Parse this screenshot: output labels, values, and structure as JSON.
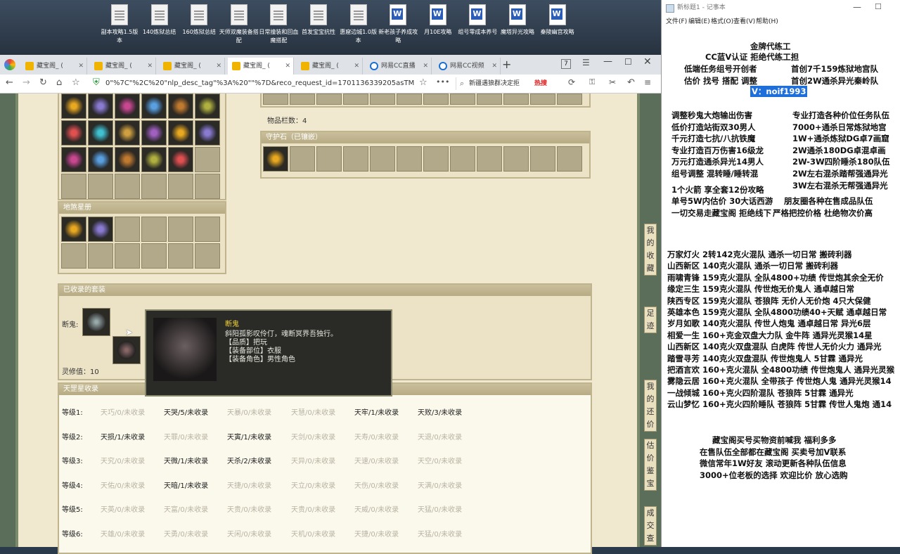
{
  "desktop": {
    "icons": [
      {
        "label": "副本攻略1.5版本",
        "type": "doc"
      },
      {
        "label": "140炼狱总结",
        "type": "doc"
      },
      {
        "label": "160炼狱总结",
        "type": "doc"
      },
      {
        "label": "天师双魔装备搭配",
        "type": "doc"
      },
      {
        "label": "日常撞装和回血魔搭配",
        "type": "doc"
      },
      {
        "label": "首发宝宝抗性",
        "type": "doc"
      },
      {
        "label": "惠窟边城1.0版本",
        "type": "doc"
      },
      {
        "label": "新老孩子养成攻略",
        "type": "word"
      },
      {
        "label": "月10E攻略",
        "type": "word"
      },
      {
        "label": "组号零成本养号",
        "type": "word"
      },
      {
        "label": "魔塔异光攻略",
        "type": "word"
      },
      {
        "label": "秦陵幽宫攻略",
        "type": "word"
      }
    ]
  },
  "browser": {
    "tabs": [
      {
        "label": "藏宝阁_ ("
      },
      {
        "label": "藏宝阁_ ("
      },
      {
        "label": "藏宝阁_ ("
      },
      {
        "label": "藏宝阁_ ("
      },
      {
        "label": "藏宝阁_ ("
      },
      {
        "label": "网易CC直播"
      },
      {
        "label": "网易CC视频"
      }
    ],
    "tab_count": "7",
    "url": "0\"%7C\"%2C%20\"nlp_desc_tag\"%3A%20\"\"%7D&reco_request_id=1701136339205asTM7",
    "search_text": "新疆遇狼群决定拒",
    "hot_label": "热搜"
  },
  "page": {
    "item_count_label": "物品栏数：4",
    "guard_stone_title": "守护石（已镶嵌）",
    "star_book_title": "地煞星册",
    "collected_sets_title": "已收录的套装",
    "set_label": "断鬼:",
    "spirit_label": "灵修值：10",
    "tiangang_title": "天罡星收录",
    "tiangang_rows": [
      {
        "label": "等级1:",
        "cells": [
          {
            "t": "天巧/0/未收录",
            "on": false
          },
          {
            "t": "天哭/5/未收录",
            "on": true
          },
          {
            "t": "天暴/0/未收录",
            "on": false
          },
          {
            "t": "天慧/0/未收录",
            "on": false
          },
          {
            "t": "天牢/1/未收录",
            "on": true
          },
          {
            "t": "天败/3/未收录",
            "on": true
          }
        ]
      },
      {
        "label": "等级2:",
        "cells": [
          {
            "t": "天损/1/未收录",
            "on": true
          },
          {
            "t": "天罪/0/未收录",
            "on": false
          },
          {
            "t": "天寅/1/未收录",
            "on": true
          },
          {
            "t": "天剑/0/未收录",
            "on": false
          },
          {
            "t": "天寿/0/未收录",
            "on": false
          },
          {
            "t": "天退/0/未收录",
            "on": false
          }
        ]
      },
      {
        "label": "等级3:",
        "cells": [
          {
            "t": "天究/0/未收录",
            "on": false
          },
          {
            "t": "天微/1/未收录",
            "on": true
          },
          {
            "t": "天杀/2/未收录",
            "on": true
          },
          {
            "t": "天异/0/未收录",
            "on": false
          },
          {
            "t": "天速/0/未收录",
            "on": false
          },
          {
            "t": "天空/0/未收录",
            "on": false
          }
        ]
      },
      {
        "label": "等级4:",
        "cells": [
          {
            "t": "天佑/0/未收录",
            "on": false
          },
          {
            "t": "天暗/1/未收录",
            "on": true
          },
          {
            "t": "天捷/0/未收录",
            "on": false
          },
          {
            "t": "天立/0/未收录",
            "on": false
          },
          {
            "t": "天伤/0/未收录",
            "on": false
          },
          {
            "t": "天满/0/未收录",
            "on": false
          }
        ]
      },
      {
        "label": "等级5:",
        "cells": [
          {
            "t": "天英/0/未收录",
            "on": false
          },
          {
            "t": "天富/0/未收录",
            "on": false
          },
          {
            "t": "天贵/0/未收录",
            "on": false
          },
          {
            "t": "天贵/0/未收录",
            "on": false
          },
          {
            "t": "天威/0/未收录",
            "on": false
          },
          {
            "t": "天猛/0/未收录",
            "on": false
          }
        ]
      },
      {
        "label": "等级6:",
        "cells": [
          {
            "t": "天雄/0/未收录",
            "on": false
          },
          {
            "t": "天勇/0/未收录",
            "on": false
          },
          {
            "t": "天闲/0/未收录",
            "on": false
          },
          {
            "t": "天机/0/未收录",
            "on": false
          },
          {
            "t": "天捷/0/未收录",
            "on": false
          },
          {
            "t": "天猛/0/未收录",
            "on": false
          }
        ]
      }
    ],
    "tooltip": {
      "title": "断鬼",
      "desc": "斜阳孤影叹伶仃，魂断冥界吾独行。",
      "quality": "【品质】把玩",
      "slot": "【装备部位】衣服",
      "role": "【装备角色】男性角色"
    },
    "side_text": [
      "我",
      "的",
      "收",
      "藏",
      "足",
      "迹",
      "我",
      "的",
      "还",
      "价",
      "估",
      "价",
      "鉴",
      "宝",
      "成",
      "交",
      "查"
    ]
  },
  "notepad": {
    "title": "新标题1 - 记事本",
    "menu": [
      "文件(F)",
      "编辑(E)",
      "格式(O)",
      "查看(V)",
      "帮助(H)"
    ],
    "top_lines": [
      "金牌代练工",
      "CC蓝V认证 拒绝代练工担",
      "低端任务组号开创者",
      "首创7千159炼狱地宫队",
      "估价 找号 搭配 调整",
      "首创2W通杀异光秦岭队",
      "V：noif1993"
    ],
    "service_left": [
      "调整秒鬼大炮输出伤害",
      "低价打造站街双30男人",
      "千元打造七抗/八抗铁魔",
      "专业打造百万伤害16级龙",
      "万元打造通杀异光14男人",
      "组号调整 混转睡/睡转混",
      "1个火箭 享全套12份攻略",
      "单号5W内估价 30大话西游",
      "一切交易走藏宝阁 拒绝线下"
    ],
    "service_right": [
      "专业打造各种价位任务队伍",
      "7000+通杀日常炼狱地宫",
      "1W+通杀炼狱DG卓7画窟",
      "2W通杀180DG卓混卓画",
      "2W-3W四阶睡杀180队伍",
      "2W左右混杀踏帮强通异光",
      "3W左右混杀无帮强通异光",
      "朋友圈各种在售成品队伍",
      "严格把控价格 杜绝物次价高"
    ],
    "teams": [
      "万家灯火 2转142克火混队 通杀一切日常 搬砖利器",
      "山西新区 140克火混队 通杀一切日常 搬砖利器",
      "雨啸青锋 159克火混队 全队4800+功绩 传世炮其余全无价",
      "缘定三生 159克火混队 传世炮无价鬼人 通卓越日常",
      "陕西专区 159克火混队 苍狼阵 无价人无价炮 4只大保健",
      "英雄本色 159克火混队 全队4800功绩40+天赋 通卓越日常",
      "岁月如歌 140克火混队 传世人炮鬼 通卓越日常 异光6层",
      "相爱一生 160+克金双盘大力队 金牛阵 通异光灵猴14星",
      "山西新区 140克火双盘混队 白虎阵 传世人无价火力 通异光",
      "踏雪寻芳 140克火双盘混队 传世炮鬼人 5甘霖 通异光",
      "把酒言欢 160+克火混队 全4800功绩 传世炮鬼人 通异光灵猴",
      "雾隐云居 160+克火混队 全带孩子 传世炮人鬼 通异光灵猴14",
      "一战倾城 160+克火四阶混队 苍狼阵 5甘霖 通异光",
      "云山梦忆 160+克火四阶睡队 苍狼阵 5甘霖 传世人鬼炮 通14"
    ],
    "bottom_lines": [
      "藏宝阁买号买物资前喊我 福利多多",
      "在售队伍全部都在藏宝阁 买卖号加V联系",
      "微信常年1W好友 滚动更新各种队伍信息",
      "3000+位老板的选择 欢迎比价 放心选购"
    ]
  },
  "colors": {
    "accent": "#1e6fd9",
    "hot": "#e02020",
    "tooltip_title": "#f2d23a",
    "panel_head": "#b7ab84"
  }
}
